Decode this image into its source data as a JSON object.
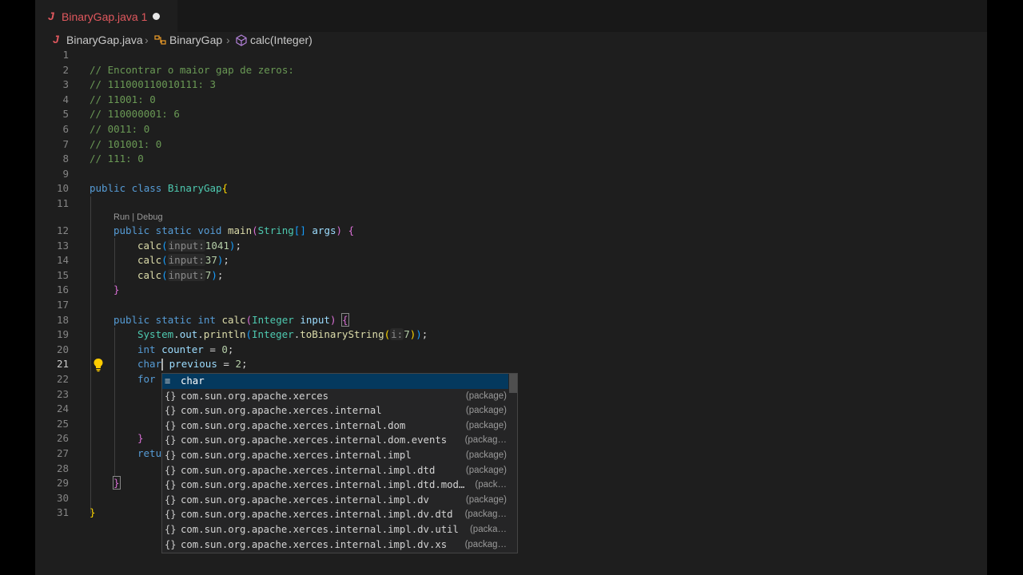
{
  "tab": {
    "filename": "BinaryGap.java",
    "problems": "1"
  },
  "breadcrumb": {
    "file": "BinaryGap.java",
    "klass": "BinaryGap",
    "method": "calc(Integer)"
  },
  "codelens": "Run | Debug",
  "lines": [
    "1",
    "2",
    "3",
    "4",
    "5",
    "6",
    "7",
    "8",
    "9",
    "10",
    "11",
    "12",
    "13",
    "14",
    "15",
    "16",
    "17",
    "18",
    "19",
    "20",
    "21",
    "22",
    "23",
    "24",
    "25",
    "26",
    "27",
    "28",
    "29",
    "30",
    "31"
  ],
  "code": {
    "c2": "// Encontrar o maior gap de zeros:",
    "c3": "// 111000110010111: 3",
    "c4": "// 11001: 0",
    "c5": "// 110000001: 6",
    "c6": "// 0011: 0",
    "c7": "// 101001: 0",
    "c8": "// 111: 0",
    "l10_kw": "public class ",
    "l10_ty": "BinaryGap",
    "l12_kw": "public static void ",
    "l12_fn": "main",
    "l12_ty": "String",
    "l12_pr": "args",
    "calc": "calc",
    "hint": "input:",
    "l13_n": "1041",
    "l14_n": "37",
    "l15_n": "7",
    "l18_kw": "public static int ",
    "l18_ty": "Integer",
    "l18_pr": "input",
    "l19_ty": "System",
    "l19_out": "out",
    "l19_fn": "println",
    "l19_ty2": "Integer",
    "l19_fn2": "toBinaryString",
    "l19_hint": "i:",
    "l19_n": "7",
    "l20_kw": "int ",
    "l20_pr": "counter",
    "l20_n": "0",
    "l21_kw": "char",
    "l21_pr": "previous",
    "l21_n": "2",
    "l22_kw": "for",
    "l27_kw": "retu"
  },
  "suggest": {
    "items": [
      {
        "label": "char",
        "detail": ""
      },
      {
        "label": "com.sun.org.apache.xerces",
        "detail": "(package)"
      },
      {
        "label": "com.sun.org.apache.xerces.internal",
        "detail": "(package)"
      },
      {
        "label": "com.sun.org.apache.xerces.internal.dom",
        "detail": "(package)"
      },
      {
        "label": "com.sun.org.apache.xerces.internal.dom.events",
        "detail": "(packag…"
      },
      {
        "label": "com.sun.org.apache.xerces.internal.impl",
        "detail": "(package)"
      },
      {
        "label": "com.sun.org.apache.xerces.internal.impl.dtd",
        "detail": "(package)"
      },
      {
        "label": "com.sun.org.apache.xerces.internal.impl.dtd.mod…",
        "detail": "(pack…"
      },
      {
        "label": "com.sun.org.apache.xerces.internal.impl.dv",
        "detail": "(package)"
      },
      {
        "label": "com.sun.org.apache.xerces.internal.impl.dv.dtd",
        "detail": "(packag…"
      },
      {
        "label": "com.sun.org.apache.xerces.internal.impl.dv.util",
        "detail": "(packa…"
      },
      {
        "label": "com.sun.org.apache.xerces.internal.impl.dv.xs",
        "detail": "(packag…"
      }
    ]
  }
}
